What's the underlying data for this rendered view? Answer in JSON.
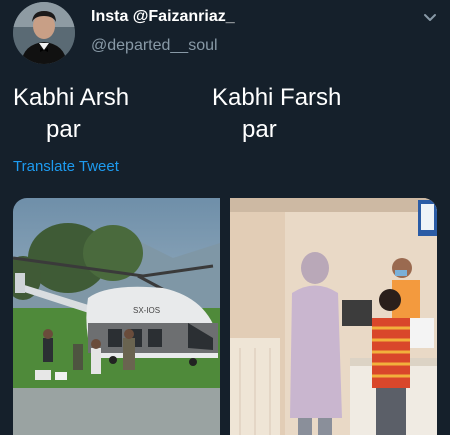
{
  "author": {
    "display_name": "Insta @Faizanriaz_",
    "handle": "@departed__soul"
  },
  "tweet": {
    "line1_left": "Kabhi Arsh",
    "line2_left": "par",
    "line1_right": "Kabhi Farsh",
    "line2_right": "par"
  },
  "translate_label": "Translate Tweet",
  "media": {
    "left_image": "helicopter-photo",
    "right_image": "counter-queue-photo",
    "helicopter_text": "SX-IOS"
  },
  "icons": {
    "menu": "chevron-down-icon"
  },
  "colors": {
    "background": "#15202b",
    "link": "#1d9bf0",
    "secondary_text": "#8899a6"
  }
}
